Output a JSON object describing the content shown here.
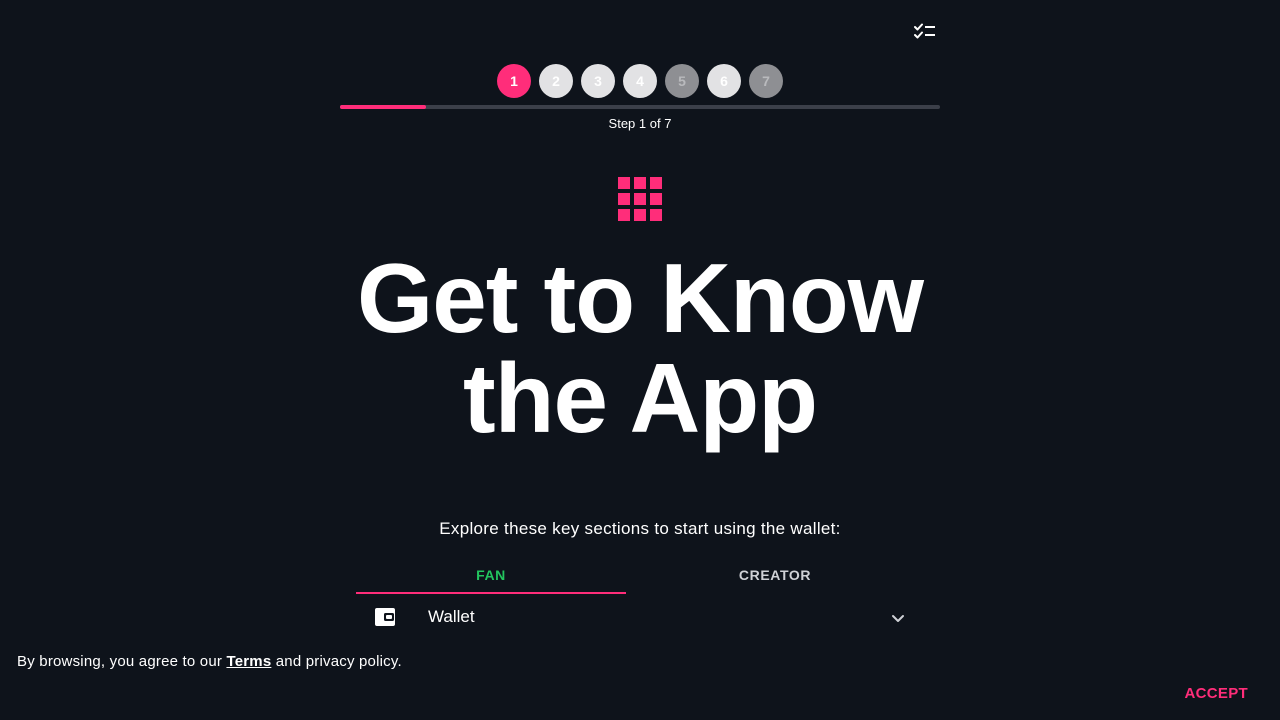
{
  "colors": {
    "background": "#0e131b",
    "accent": "#ff2d7a",
    "fan_tab": "#22c55e"
  },
  "icons": {
    "logo": "crescent-moon-icon",
    "checklist": "checklist-icon",
    "hero": "grid-icon",
    "wallet": "wallet-icon",
    "expand": "chevron-down-icon"
  },
  "steps": {
    "items": [
      "1",
      "2",
      "3",
      "4",
      "5",
      "6",
      "7"
    ],
    "current": 1,
    "total": 7,
    "progress_fraction": 0.1429,
    "caption": "Step 1 of 7"
  },
  "hero": {
    "title_line1": "Get to Know",
    "title_line2": "the App"
  },
  "intro": {
    "text": "Explore these key sections to start using the wallet:"
  },
  "tabs": {
    "fan": "FAN",
    "creator": "CREATOR",
    "selected": "FAN"
  },
  "sections": [
    {
      "label": "Wallet",
      "expanded": false
    }
  ],
  "cookie": {
    "prefix": "By browsing, you agree to our ",
    "link": "Terms",
    "suffix": " and privacy policy.",
    "accept": "ACCEPT"
  }
}
